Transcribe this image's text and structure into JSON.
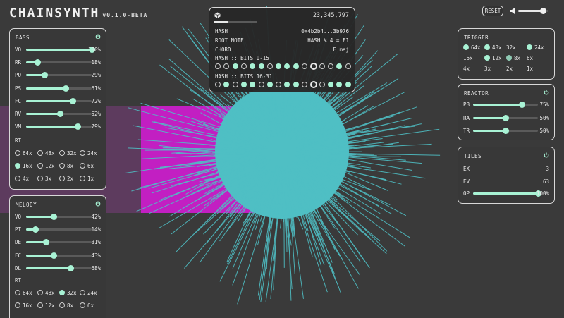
{
  "app": {
    "title": "CHAINSYNTH",
    "version": "v0.1.0-BETA"
  },
  "header": {
    "reset_label": "RESET",
    "volume": 0.82
  },
  "colors": {
    "accent": "#a8f2d4",
    "burst": "#4fbfc4",
    "magenta": "#c21fc2"
  },
  "hash_panel": {
    "icon": "cube-icon",
    "block_number": "23,345,797",
    "progress": 0.34,
    "rows": [
      {
        "label": "HASH",
        "value": "0x4b2b4...3b976"
      },
      {
        "label": "ROOT NOTE",
        "value": "HASH % 4 = F1"
      },
      {
        "label": "CHORD",
        "value": "F maj"
      }
    ],
    "bits_0_15_label": "HASH :: BITS 0-15",
    "bits_0_15": [
      0,
      0,
      1,
      0,
      1,
      1,
      0,
      1,
      1,
      1,
      0,
      2,
      0,
      0,
      1,
      0
    ],
    "bits_16_31_label": "HASH :: BITS 16-31",
    "bits_16_31": [
      0,
      1,
      0,
      1,
      1,
      0,
      1,
      0,
      1,
      1,
      0,
      2,
      0,
      1,
      1,
      1
    ]
  },
  "bass": {
    "title": "BASS",
    "params": [
      {
        "label": "VO",
        "value": "100%",
        "level": 1.0
      },
      {
        "label": "RR",
        "value": "18%",
        "level": 0.18
      },
      {
        "label": "PO",
        "value": "29%",
        "level": 0.29
      },
      {
        "label": "PS",
        "value": "61%",
        "level": 0.61
      },
      {
        "label": "FC",
        "value": "72%",
        "level": 0.72
      },
      {
        "label": "RV",
        "value": "52%",
        "level": 0.52
      },
      {
        "label": "VM",
        "value": "79%",
        "level": 0.79
      }
    ],
    "rt_label": "RT",
    "rt_options": [
      {
        "label": "64x",
        "state": "off"
      },
      {
        "label": "48x",
        "state": "off"
      },
      {
        "label": "32x",
        "state": "off"
      },
      {
        "label": "24x",
        "state": "off"
      },
      {
        "label": "16x",
        "state": "on"
      },
      {
        "label": "12x",
        "state": "off"
      },
      {
        "label": "8x",
        "state": "off"
      },
      {
        "label": "6x",
        "state": "off"
      },
      {
        "label": "4x",
        "state": "off"
      },
      {
        "label": "3x",
        "state": "off"
      },
      {
        "label": "2x",
        "state": "off"
      },
      {
        "label": "1x",
        "state": "off"
      }
    ]
  },
  "melody": {
    "title": "MELODY",
    "params": [
      {
        "label": "VO",
        "value": "42%",
        "level": 0.42
      },
      {
        "label": "PT",
        "value": "14%",
        "level": 0.14
      },
      {
        "label": "DE",
        "value": "31%",
        "level": 0.31
      },
      {
        "label": "FC",
        "value": "43%",
        "level": 0.43
      },
      {
        "label": "DL",
        "value": "68%",
        "level": 0.68
      }
    ],
    "rt_label": "RT",
    "rt_options": [
      {
        "label": "64x",
        "state": "off"
      },
      {
        "label": "48x",
        "state": "off"
      },
      {
        "label": "32x",
        "state": "on"
      },
      {
        "label": "24x",
        "state": "off"
      },
      {
        "label": "16x",
        "state": "off"
      },
      {
        "label": "12x",
        "state": "off"
      },
      {
        "label": "8x",
        "state": "off"
      },
      {
        "label": "6x",
        "state": "off"
      }
    ]
  },
  "trigger": {
    "title": "TRIGGER",
    "options": [
      {
        "label": "64x",
        "state": "on"
      },
      {
        "label": "48x",
        "state": "on"
      },
      {
        "label": "32x",
        "state": "none"
      },
      {
        "label": "24x",
        "state": "on"
      },
      {
        "label": "16x",
        "state": "none"
      },
      {
        "label": "12x",
        "state": "on"
      },
      {
        "label": "8x",
        "state": "dim"
      },
      {
        "label": "6x",
        "state": "none"
      },
      {
        "label": "4x",
        "state": "none"
      },
      {
        "label": "3x",
        "state": "none"
      },
      {
        "label": "2x",
        "state": "none"
      },
      {
        "label": "1x",
        "state": "none"
      }
    ]
  },
  "reactor": {
    "title": "REACTOR",
    "params": [
      {
        "label": "PB",
        "value": "75%",
        "level": 0.75
      },
      {
        "label": "RA",
        "value": "50%",
        "level": 0.5
      },
      {
        "label": "TR",
        "value": "50%",
        "level": 0.5
      }
    ]
  },
  "tiles": {
    "title": "TILES",
    "rows": [
      {
        "label": "EX",
        "value": "3"
      },
      {
        "label": "EV",
        "value": "63"
      }
    ],
    "op": {
      "label": "OP",
      "value": "100%",
      "level": 1.0
    }
  }
}
